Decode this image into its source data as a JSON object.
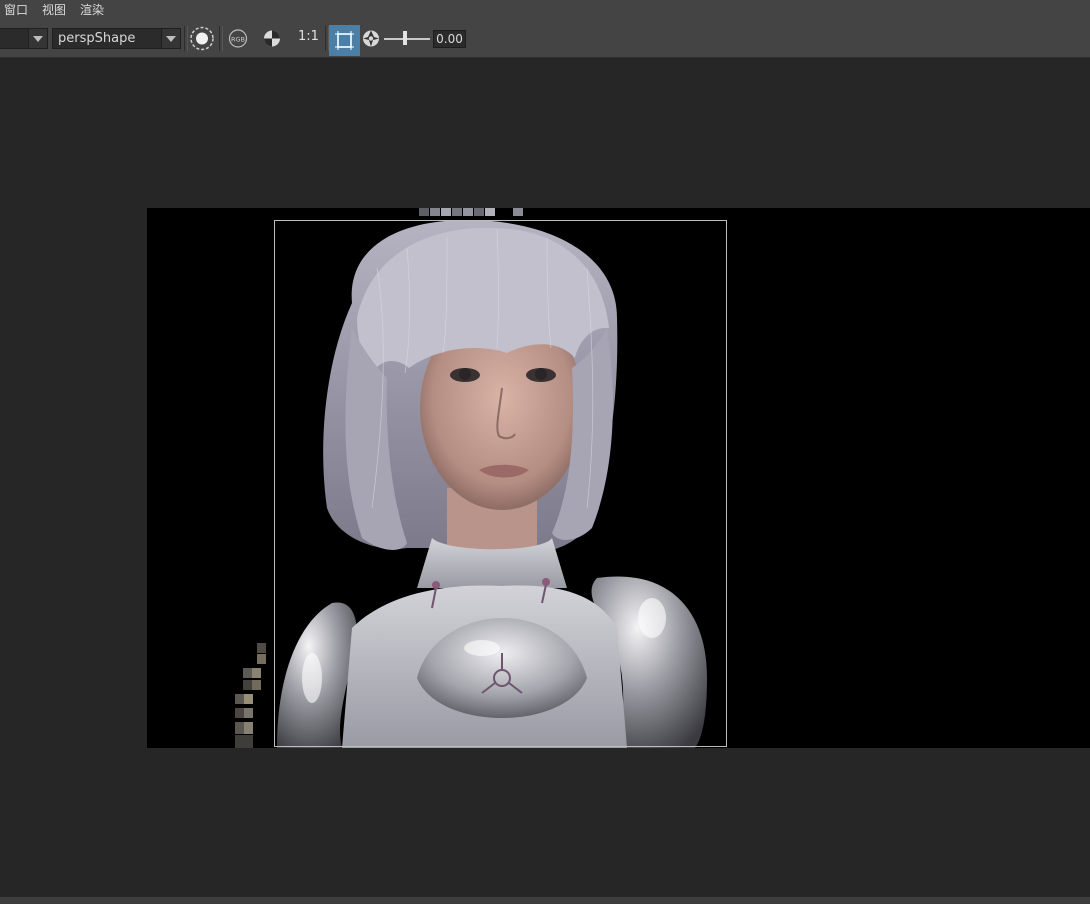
{
  "menu": {
    "items": [
      "窗口",
      "视图",
      "渲染"
    ]
  },
  "toolbar": {
    "display_dropdown": {
      "value": ""
    },
    "camera_dropdown": {
      "value": "perspShape"
    },
    "ratio_label": "1:1",
    "exposure_value": "0.00"
  },
  "icons": {
    "snapshot": "aperture-ring-icon",
    "rgb": "rgb-channel-icon",
    "color_mgmt": "checker-circle-icon",
    "region": "region-render-icon",
    "exposure": "aperture-icon"
  },
  "colors": {
    "ui_bg": "#262626",
    "toolbar_bg": "#444444",
    "active_button": "#4c7fa6",
    "render_bg": "#000000"
  }
}
